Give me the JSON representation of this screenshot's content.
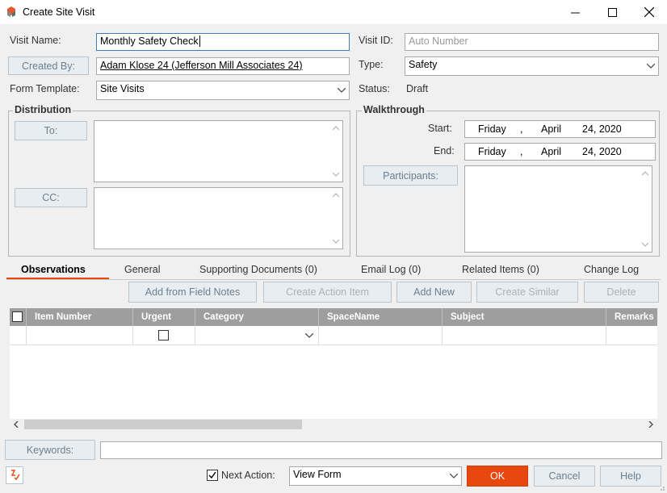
{
  "window": {
    "title": "Create Site Visit"
  },
  "form": {
    "visit_name_label": "Visit Name:",
    "visit_name_value": "Monthly Safety Check",
    "created_by_label": "Created By:",
    "created_by_value": "Adam Klose 24 (Jefferson Mill Associates 24)",
    "form_template_label": "Form Template:",
    "form_template_value": "Site Visits",
    "visit_id_label": "Visit ID:",
    "visit_id_placeholder": "Auto Number",
    "type_label": "Type:",
    "type_value": "Safety",
    "status_label": "Status:",
    "status_value": "Draft"
  },
  "distribution": {
    "title": "Distribution",
    "to_label": "To:",
    "cc_label": "CC:"
  },
  "walkthrough": {
    "title": "Walkthrough",
    "start_label": "Start:",
    "start_day": "Friday",
    "start_sep": ",",
    "start_month": "April",
    "start_date": "24, 2020",
    "end_label": "End:",
    "end_day": "Friday",
    "end_sep": ",",
    "end_month": "April",
    "end_date": "24, 2020",
    "participants_label": "Participants:"
  },
  "tabs": [
    {
      "label": "Observations",
      "active": true
    },
    {
      "label": "General"
    },
    {
      "label": "Supporting Documents (0)"
    },
    {
      "label": "Email Log (0)"
    },
    {
      "label": "Related Items (0)"
    },
    {
      "label": "Change Log"
    }
  ],
  "toolbar": {
    "add_from_field_notes": "Add from Field Notes",
    "create_action_item": "Create Action Item",
    "add_new": "Add New",
    "create_similar": "Create Similar",
    "delete": "Delete"
  },
  "grid": {
    "columns": [
      "Item Number",
      "Urgent",
      "Category",
      "SpaceName",
      "Subject",
      "Remarks"
    ]
  },
  "footer": {
    "keywords_label": "Keywords:",
    "next_action_label": "Next Action:",
    "next_action_checked": true,
    "next_action_value": "View Form",
    "ok": "OK",
    "cancel": "Cancel",
    "help": "Help"
  },
  "colors": {
    "accent": "#e8470e",
    "tab_underline": "#e8470e",
    "grid_header": "#9e9e9e"
  }
}
